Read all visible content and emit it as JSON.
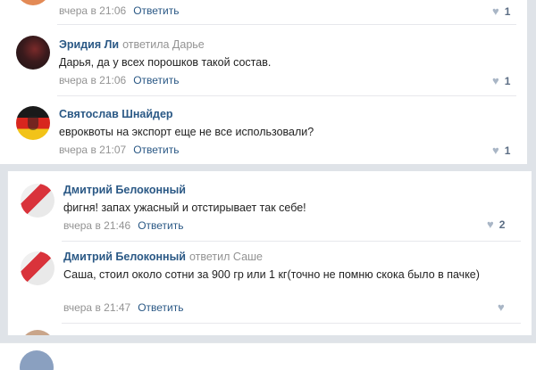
{
  "comments_top": [
    {
      "author": "",
      "reply_to": "",
      "text": "",
      "time": "вчера в 21:06",
      "answer_label": "Ответить",
      "likes": "1"
    },
    {
      "author": "Эридия Ли",
      "reply_to": "ответила Дарье",
      "text": "Дарья, да у всех порошков такой состав.",
      "time": "вчера в 21:06",
      "answer_label": "Ответить",
      "likes": "1"
    },
    {
      "author": "Святослав Шнайдер",
      "reply_to": "",
      "text": "евроквоты на экспорт еще не все использовали?",
      "time": "вчера в 21:07",
      "answer_label": "Ответить",
      "likes": "1"
    }
  ],
  "comments_bottom": [
    {
      "author": "Дмитрий Белоконный",
      "reply_to": "",
      "text": "фигня! запах ужасный и отстирывает так себе!",
      "time": "вчера в 21:46",
      "answer_label": "Ответить",
      "likes": "2"
    },
    {
      "author": "Дмитрий Белоконный",
      "reply_to": "ответил Саше",
      "text": "Саша, стоил около сотни за 900 гр или 1 кг(точно не помню скока было в пачке)",
      "time": "вчера в 21:47",
      "answer_label": "Ответить",
      "likes": ""
    }
  ],
  "icons": {
    "like": "heart-icon"
  },
  "colors": {
    "link": "#2a5885",
    "muted": "#939393",
    "background": "#dfe3e8"
  }
}
